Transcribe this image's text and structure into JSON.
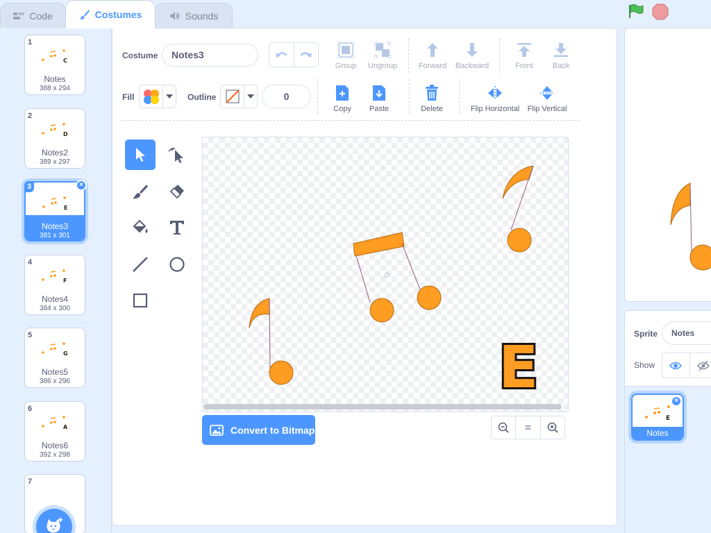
{
  "tabs": {
    "code": "Code",
    "costumes": "Costumes",
    "sounds": "Sounds"
  },
  "costumes": [
    {
      "num": "1",
      "name": "Notes",
      "size": "388 x 294",
      "letter": "C"
    },
    {
      "num": "2",
      "name": "Notes2",
      "size": "389 x 297",
      "letter": "D"
    },
    {
      "num": "3",
      "name": "Notes3",
      "size": "381 x 301",
      "letter": "E"
    },
    {
      "num": "4",
      "name": "Notes4",
      "size": "384 x 300",
      "letter": "F"
    },
    {
      "num": "5",
      "name": "Notes5",
      "size": "386 x 296",
      "letter": "G"
    },
    {
      "num": "6",
      "name": "Notes6",
      "size": "392 x 298",
      "letter": "A"
    },
    {
      "num": "7"
    }
  ],
  "editor": {
    "costume_label": "Costume",
    "costume_name": "Notes3",
    "fill_label": "Fill",
    "outline_label": "Outline",
    "outline_width": "0",
    "buttons": {
      "group": "Group",
      "ungroup": "Ungroup",
      "forward": "Forward",
      "backward": "Backward",
      "front": "Front",
      "back": "Back",
      "copy": "Copy",
      "paste": "Paste",
      "delete": "Delete",
      "flip_horizontal": "Flip Horizontal",
      "flip_vertical": "Flip Vertical"
    },
    "convert_button": "Convert to Bitmap",
    "zoom_reset": "="
  },
  "canvas": {
    "letter": "E"
  },
  "sprite": {
    "label": "Sprite",
    "name": "Notes",
    "show_label": "Show",
    "tile_name": "Notes",
    "tile_letter": "E"
  },
  "colors": {
    "accent": "#4c97ff",
    "note_fill": "#ff9c22",
    "green_flag": "#4cbf56",
    "stop": "#ec9c9c"
  }
}
